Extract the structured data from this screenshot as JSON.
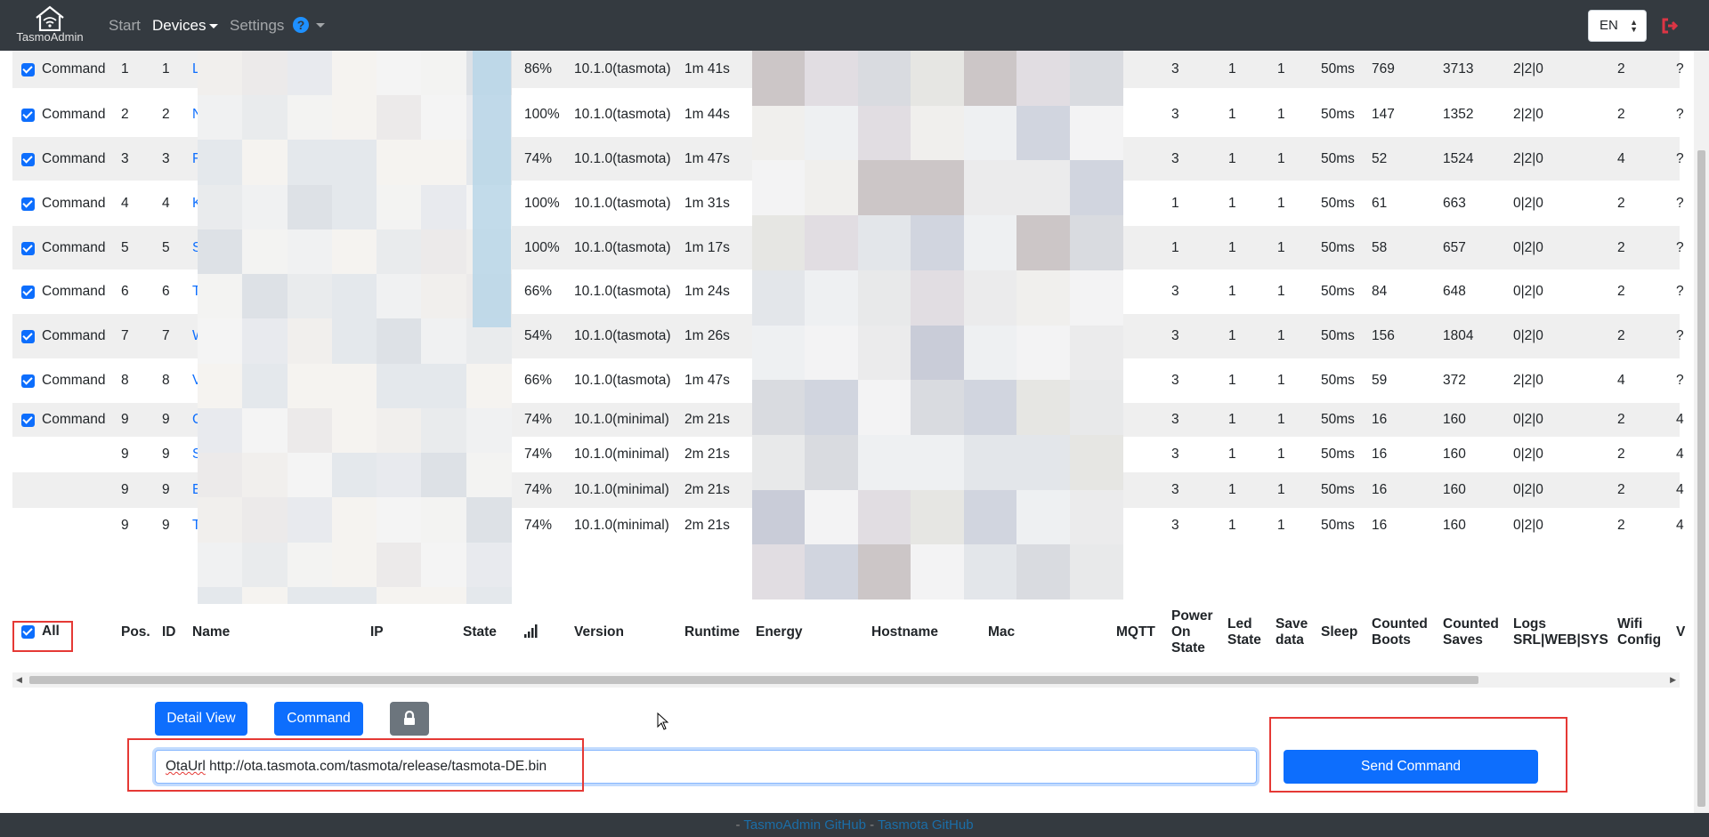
{
  "navbar": {
    "brand": "TasmoAdmin",
    "links": [
      "Start",
      "Devices",
      "Settings"
    ],
    "language": "EN",
    "help_icon": "question-circle-icon",
    "logout_icon": "logout-icon",
    "colors": {
      "bg": "#343a40",
      "accent": "#0d6efd",
      "logout": "#dc3545"
    }
  },
  "rows": [
    {
      "cmd": "Command",
      "pos": "1",
      "id": "1",
      "name": "L",
      "signal": "86%",
      "version": "10.1.0(tasmota)",
      "runtime": "1m 41s",
      "pos_on": "3",
      "led": "1",
      "save": "1",
      "sleep": "50ms",
      "boots": "769",
      "saves": "3713",
      "logs": "2|2|0",
      "wifi": "2",
      "more": "?"
    },
    {
      "cmd": "Command",
      "pos": "2",
      "id": "2",
      "name": "N",
      "signal": "100%",
      "version": "10.1.0(tasmota)",
      "runtime": "1m 44s",
      "pos_on": "3",
      "led": "1",
      "save": "1",
      "sleep": "50ms",
      "boots": "147",
      "saves": "1352",
      "logs": "2|2|0",
      "wifi": "2",
      "more": "?"
    },
    {
      "cmd": "Command",
      "pos": "3",
      "id": "3",
      "name": "F",
      "signal": "74%",
      "version": "10.1.0(tasmota)",
      "runtime": "1m 47s",
      "pos_on": "3",
      "led": "1",
      "save": "1",
      "sleep": "50ms",
      "boots": "52",
      "saves": "1524",
      "logs": "2|2|0",
      "wifi": "4",
      "more": "?"
    },
    {
      "cmd": "Command",
      "pos": "4",
      "id": "4",
      "name": "K",
      "signal": "100%",
      "version": "10.1.0(tasmota)",
      "runtime": "1m 31s",
      "pos_on": "1",
      "led": "1",
      "save": "1",
      "sleep": "50ms",
      "boots": "61",
      "saves": "663",
      "logs": "0|2|0",
      "wifi": "2",
      "more": "?"
    },
    {
      "cmd": "Command",
      "pos": "5",
      "id": "5",
      "name": "S",
      "signal": "100%",
      "version": "10.1.0(tasmota)",
      "runtime": "1m 17s",
      "pos_on": "1",
      "led": "1",
      "save": "1",
      "sleep": "50ms",
      "boots": "58",
      "saves": "657",
      "logs": "0|2|0",
      "wifi": "2",
      "more": "?"
    },
    {
      "cmd": "Command",
      "pos": "6",
      "id": "6",
      "name": "T",
      "signal": "66%",
      "version": "10.1.0(tasmota)",
      "runtime": "1m 24s",
      "pos_on": "3",
      "led": "1",
      "save": "1",
      "sleep": "50ms",
      "boots": "84",
      "saves": "648",
      "logs": "0|2|0",
      "wifi": "2",
      "more": "?"
    },
    {
      "cmd": "Command",
      "pos": "7",
      "id": "7",
      "name": "W",
      "signal": "54%",
      "version": "10.1.0(tasmota)",
      "runtime": "1m 26s",
      "pos_on": "3",
      "led": "1",
      "save": "1",
      "sleep": "50ms",
      "boots": "156",
      "saves": "1804",
      "logs": "0|2|0",
      "wifi": "2",
      "more": "?"
    },
    {
      "cmd": "Command",
      "pos": "8",
      "id": "8",
      "name": "V",
      "signal": "66%",
      "version": "10.1.0(tasmota)",
      "runtime": "1m 47s",
      "pos_on": "3",
      "led": "1",
      "save": "1",
      "sleep": "50ms",
      "boots": "59",
      "saves": "372",
      "logs": "2|2|0",
      "wifi": "4",
      "more": "?"
    },
    {
      "cmd": "Command",
      "pos": "9",
      "id": "9",
      "name": "C",
      "signal": "74%",
      "version": "10.1.0(minimal)",
      "runtime": "2m 21s",
      "pos_on": "3",
      "led": "1",
      "save": "1",
      "sleep": "50ms",
      "boots": "16",
      "saves": "160",
      "logs": "0|2|0",
      "wifi": "2",
      "more": "4"
    },
    {
      "cmd": "",
      "pos": "9",
      "id": "9",
      "name": "S",
      "signal": "74%",
      "version": "10.1.0(minimal)",
      "runtime": "2m 21s",
      "pos_on": "3",
      "led": "1",
      "save": "1",
      "sleep": "50ms",
      "boots": "16",
      "saves": "160",
      "logs": "0|2|0",
      "wifi": "2",
      "more": "4"
    },
    {
      "cmd": "",
      "pos": "9",
      "id": "9",
      "name": "E",
      "signal": "74%",
      "version": "10.1.0(minimal)",
      "runtime": "2m 21s",
      "pos_on": "3",
      "led": "1",
      "save": "1",
      "sleep": "50ms",
      "boots": "16",
      "saves": "160",
      "logs": "0|2|0",
      "wifi": "2",
      "more": "4"
    },
    {
      "cmd": "",
      "pos": "9",
      "id": "9",
      "name": "T",
      "signal": "74%",
      "version": "10.1.0(minimal)",
      "runtime": "2m 21s",
      "pos_on": "3",
      "led": "1",
      "save": "1",
      "sleep": "50ms",
      "boots": "16",
      "saves": "160",
      "logs": "0|2|0",
      "wifi": "2",
      "more": "4"
    }
  ],
  "header": {
    "all": "All",
    "pos": "Pos.",
    "id": "ID",
    "name": "Name",
    "ip": "IP",
    "state": "State",
    "signal_icon": "signal-bars-icon",
    "version": "Version",
    "runtime": "Runtime",
    "energy": "Energy",
    "hostname": "Hostname",
    "mac": "Mac",
    "mqtt": "MQTT",
    "power_on_state": [
      "Power",
      "On",
      "State"
    ],
    "led_state": [
      "Led",
      "State"
    ],
    "save_data": [
      "Save",
      "data"
    ],
    "sleep": "Sleep",
    "counted_boots": [
      "Counted",
      "Boots"
    ],
    "counted_saves": [
      "Counted",
      "Saves"
    ],
    "logs": [
      "Logs",
      "SRL|WEB|SYS"
    ],
    "wifi_config": [
      "Wifi",
      "Config"
    ],
    "more": "V"
  },
  "actions": {
    "detail_view": "Detail View",
    "command": "Command",
    "lock_icon": "lock-icon",
    "command_value_prefix": "OtaUrl",
    "command_value_rest": " http://ota.tasmota.com/tasmota/release/tasmota-DE.bin",
    "send_command": "Send Command"
  },
  "footer": {
    "sep": "-",
    "link1": "TasmoAdmin GitHub",
    "link2": "Tasmota GitHub"
  }
}
